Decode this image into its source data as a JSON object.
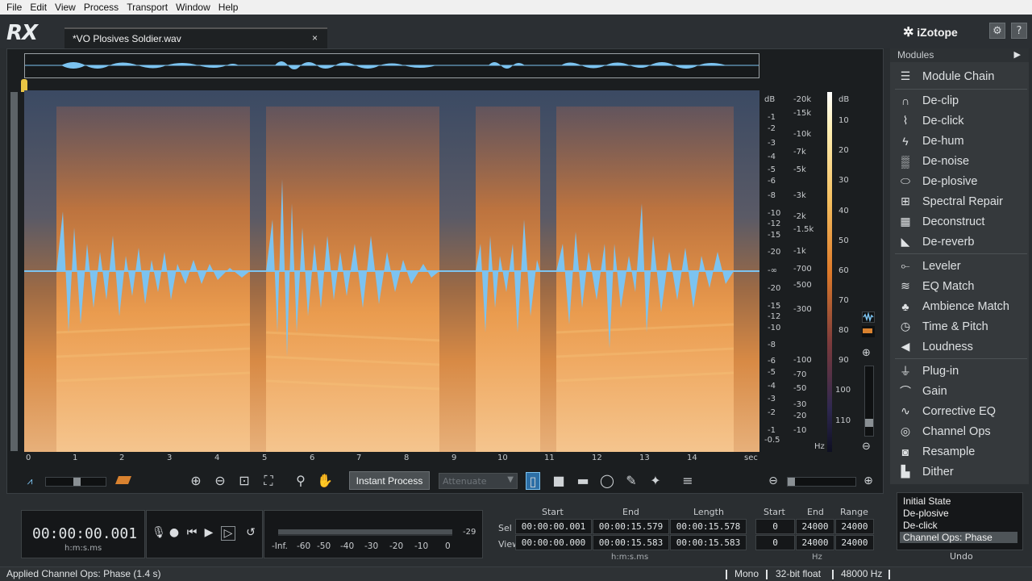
{
  "menu": [
    "File",
    "Edit",
    "View",
    "Process",
    "Transport",
    "Window",
    "Help"
  ],
  "app": {
    "logo": "RX",
    "brand": "iZotope"
  },
  "tab": {
    "title": "*VO Plosives Soldier.wav",
    "close": "×"
  },
  "header_buttons": {
    "settings": "⚙",
    "help": "?"
  },
  "time_axis": {
    "ticks": [
      "0",
      "1",
      "2",
      "3",
      "4",
      "5",
      "6",
      "7",
      "8",
      "9",
      "10",
      "11",
      "12",
      "13",
      "14"
    ],
    "unit": "sec"
  },
  "db_axis": {
    "top": [
      "dB",
      "-1",
      "-2",
      "-3",
      "-4",
      "-5",
      "-6",
      "-8",
      "-10",
      "-12",
      "-15",
      "-20"
    ],
    "center": "-∞",
    "bottom": [
      "-20",
      "-15",
      "-12",
      "-10",
      "-8",
      "-6",
      "-5",
      "-4",
      "-3",
      "-2",
      "-1",
      "-0.5"
    ]
  },
  "hz_axis": {
    "labels": [
      "-20k",
      "-15k",
      "-10k",
      "-7k",
      "-5k",
      "-3k",
      "-2k",
      "-1.5k",
      "-1k",
      "-700",
      "-500",
      "-300",
      "-100",
      "-70",
      "-50",
      "-30",
      "-20",
      "-10"
    ],
    "unit": "Hz"
  },
  "colorbar_axis": {
    "labels": [
      "dB",
      "10",
      "20",
      "30",
      "40",
      "50",
      "60",
      "70",
      "80",
      "90",
      "100",
      "110"
    ]
  },
  "toolbar": {
    "instant_process": "Instant Process",
    "attenuate": "Attenuate"
  },
  "modules": {
    "header": "Modules",
    "items": [
      {
        "label": "Module Chain",
        "icon": "list-icon"
      },
      {
        "label": "De-clip",
        "icon": "declip-icon"
      },
      {
        "label": "De-click",
        "icon": "declick-icon"
      },
      {
        "label": "De-hum",
        "icon": "dehum-icon"
      },
      {
        "label": "De-noise",
        "icon": "denoise-icon"
      },
      {
        "label": "De-plosive",
        "icon": "deplosive-icon"
      },
      {
        "label": "Spectral Repair",
        "icon": "spectral-repair-icon"
      },
      {
        "label": "Deconstruct",
        "icon": "deconstruct-icon"
      },
      {
        "label": "De-reverb",
        "icon": "dereverb-icon"
      },
      {
        "label": "Leveler",
        "icon": "leveler-icon"
      },
      {
        "label": "EQ Match",
        "icon": "eq-match-icon"
      },
      {
        "label": "Ambience Match",
        "icon": "ambience-icon"
      },
      {
        "label": "Time & Pitch",
        "icon": "clock-icon"
      },
      {
        "label": "Loudness",
        "icon": "speaker-icon"
      },
      {
        "label": "Plug-in",
        "icon": "plug-icon"
      },
      {
        "label": "Gain",
        "icon": "gain-icon"
      },
      {
        "label": "Corrective EQ",
        "icon": "eq-icon"
      },
      {
        "label": "Channel Ops",
        "icon": "channel-ops-icon"
      },
      {
        "label": "Resample",
        "icon": "resample-icon"
      },
      {
        "label": "Dither",
        "icon": "dither-icon"
      }
    ]
  },
  "timecode": {
    "value": "00:00:00.001",
    "unit": "h:m:s.ms"
  },
  "meter": {
    "labels": [
      "-Inf.",
      "-60",
      "-50",
      "-40",
      "-30",
      "-20",
      "-10",
      "0"
    ],
    "peak": "-29"
  },
  "selection": {
    "headers": [
      "Start",
      "End",
      "Length"
    ],
    "rows": [
      {
        "label": "Sel",
        "values": [
          "00:00:00.001",
          "00:00:15.579",
          "00:00:15.578"
        ]
      },
      {
        "label": "View",
        "values": [
          "00:00:00.000",
          "00:00:15.583",
          "00:00:15.583"
        ]
      }
    ],
    "unit": "h:m:s.ms"
  },
  "freq": {
    "headers": [
      "Start",
      "End",
      "Range"
    ],
    "rows": [
      [
        "0",
        "24000",
        "24000"
      ],
      [
        "0",
        "24000",
        "24000"
      ]
    ],
    "unit": "Hz"
  },
  "undo": {
    "items": [
      "Initial State",
      "De-plosive",
      "De-click",
      "Channel Ops: Phase"
    ],
    "label": "Undo"
  },
  "status": {
    "message": "Applied Channel Ops: Phase (1.4 s)",
    "channels": "Mono",
    "bitdepth": "32-bit float",
    "samplerate": "48000 Hz"
  },
  "colors": {
    "waveform": "#7cc3f0",
    "accent": "#e9c544",
    "panel": "#1b1e20"
  }
}
